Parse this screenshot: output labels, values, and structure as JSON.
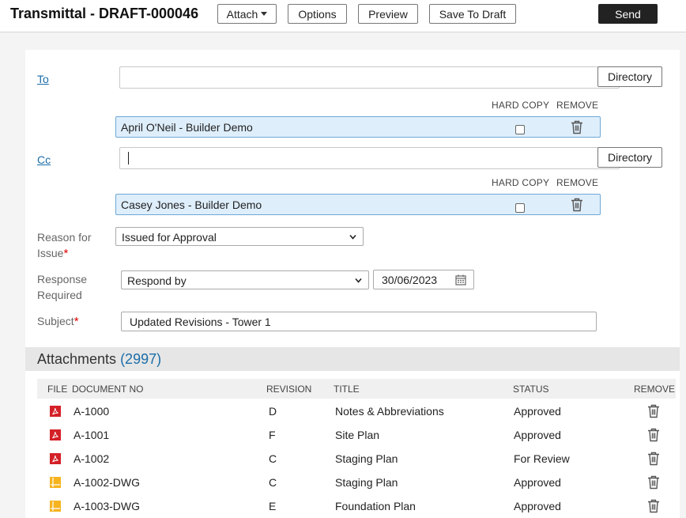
{
  "header": {
    "title": "Transmittal - DRAFT-000046",
    "attach_label": "Attach",
    "options_label": "Options",
    "preview_label": "Preview",
    "save_draft_label": "Save To Draft",
    "send_label": "Send"
  },
  "form": {
    "to_label": "To",
    "cc_label": "Cc",
    "directory_label": "Directory",
    "to_search_value": "",
    "cc_search_value": "",
    "hard_copy_label": "HARD COPY",
    "remove_label": "REMOVE",
    "to_recipients": [
      {
        "name": "April O'Neil - Builder Demo",
        "hard_copy": false
      }
    ],
    "cc_recipients": [
      {
        "name": "Casey Jones - Builder Demo",
        "hard_copy": false
      }
    ],
    "reason_label_1": "Reason for",
    "reason_label_2": "Issue",
    "reason_value": "Issued for Approval",
    "response_label_1": "Response",
    "response_label_2": "Required",
    "response_value": "Respond by",
    "response_date": "30/06/2023",
    "subject_label": "Subject",
    "subject_value": "Updated Revisions - Tower 1",
    "required_mark": "*"
  },
  "attachments": {
    "title": "Attachments",
    "count": "(2997)",
    "columns": {
      "file": "FILE",
      "document_no": "DOCUMENT NO",
      "revision": "REVISION",
      "title": "TITLE",
      "status": "STATUS",
      "remove": "REMOVE"
    },
    "rows": [
      {
        "file_type": "pdf-icon",
        "document_no": "A-1000",
        "revision": "D",
        "title": "Notes & Abbreviations",
        "status": "Approved"
      },
      {
        "file_type": "pdf-icon",
        "document_no": "A-1001",
        "revision": "F",
        "title": "Site Plan",
        "status": "Approved"
      },
      {
        "file_type": "pdf-icon",
        "document_no": "A-1002",
        "revision": "C",
        "title": "Staging Plan",
        "status": "For Review"
      },
      {
        "file_type": "dwg-icon",
        "document_no": "A-1002-DWG",
        "revision": "C",
        "title": "Staging Plan",
        "status": "Approved"
      },
      {
        "file_type": "dwg-icon",
        "document_no": "A-1003-DWG",
        "revision": "E",
        "title": "Foundation Plan",
        "status": "Approved"
      }
    ]
  },
  "colors": {
    "link": "#1a6da8",
    "recipient_bg": "#deeefb",
    "recipient_border": "#6ea8d6",
    "pdf_icon": "#d42027",
    "dwg_icon": "#f5b320",
    "send_bg": "#222222",
    "required": "#dd0000"
  }
}
